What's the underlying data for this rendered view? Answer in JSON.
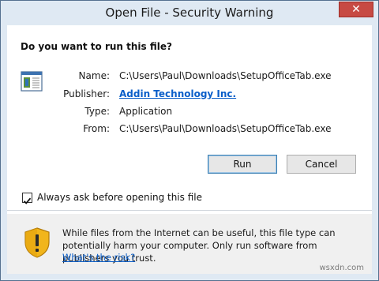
{
  "window": {
    "title": "Open File - Security Warning",
    "close_glyph": "✕"
  },
  "prompt": {
    "question": "Do you want to run this file?"
  },
  "details": [
    {
      "label": "Name:",
      "value": "C:\\Users\\Paul\\Downloads\\SetupOfficeTab.exe"
    },
    {
      "label": "Publisher:",
      "value": "Addin Technology Inc."
    },
    {
      "label": "Type:",
      "value": "Application"
    },
    {
      "label": "From:",
      "value": "C:\\Users\\Paul\\Downloads\\SetupOfficeTab.exe"
    }
  ],
  "buttons": {
    "run": "Run",
    "cancel": "Cancel"
  },
  "option": {
    "checkbox_label": "Always ask before opening this file",
    "checked": true
  },
  "warning": {
    "text": "While files from the Internet can be useful, this file type can potentially harm your computer. Only run software from publishers you trust.",
    "link": "What's the risk?"
  },
  "watermark": "wsxdn.com",
  "icons": {
    "file": "application-file-icon",
    "shield": "warning-shield-icon",
    "check": "checkmark-icon",
    "close": "close-icon"
  },
  "colors": {
    "link": "#0a5ec9",
    "close": "#c74a43",
    "frame": "#dfe9f3"
  }
}
